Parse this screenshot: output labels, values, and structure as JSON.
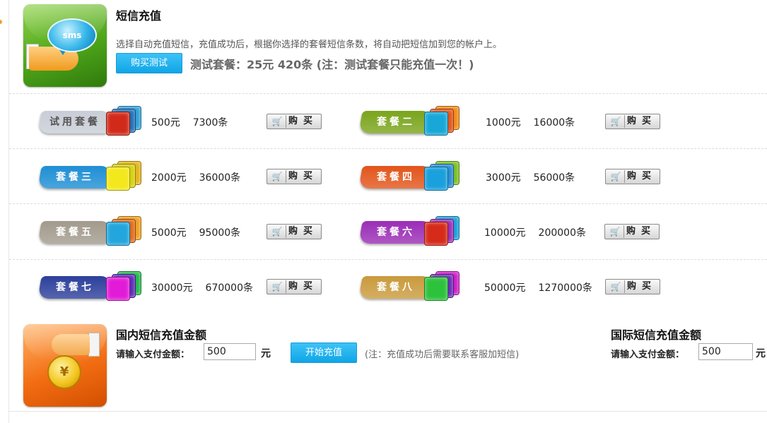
{
  "header": {
    "title": "短信充值",
    "description": "选择自动充值短信，充值成功后，根据你选择的套餐短信条数，将自动把短信加到您的帐户上。",
    "buy_test_label": "购买测试",
    "trial_note": "测试套餐：25元 420条 (注：测试套餐只能充值一次！)",
    "icon_text": "sms"
  },
  "packages": [
    {
      "name": "试用套餐",
      "price": "500元",
      "count": "7300条",
      "color": "#c8cdd6"
    },
    {
      "name": "套餐二",
      "price": "1000元",
      "count": "16000条",
      "color": "#7aa41c"
    },
    {
      "name": "套餐三",
      "price": "2000元",
      "count": "36000条",
      "color": "#1e8ed4"
    },
    {
      "name": "套餐四",
      "price": "3000元",
      "count": "56000条",
      "color": "#e2541a"
    },
    {
      "name": "套餐五",
      "price": "5000元",
      "count": "95000条",
      "color": "#a29a8c"
    },
    {
      "name": "套餐六",
      "price": "10000元",
      "count": "200000条",
      "color": "#9a2db6"
    },
    {
      "name": "套餐七",
      "price": "30000元",
      "count": "670000条",
      "color": "#2c3f9b"
    },
    {
      "name": "套餐八",
      "price": "50000元",
      "count": "1270000条",
      "color": "#c99a3c"
    }
  ],
  "buy_label": "购买",
  "domestic": {
    "title": "国内短信充值金额",
    "field_label": "请输入支付金额：",
    "amount_value": "500",
    "unit": "元",
    "start_label": "开始充值",
    "note": "(注：充值成功后需要联系客服加短信)"
  },
  "international": {
    "title": "国际短信充值金额",
    "field_label": "请输入支付金额：",
    "amount_value": "500",
    "unit": "元"
  }
}
